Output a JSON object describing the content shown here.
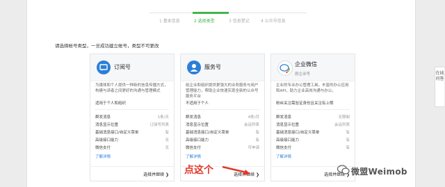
{
  "steps": [
    {
      "label": "1 基本信息",
      "active": false
    },
    {
      "label": "2 选择类型",
      "active": true
    },
    {
      "label": "3 信息登记",
      "active": false
    },
    {
      "label": "4 公众号信息",
      "active": false
    }
  ],
  "intro": "请选择帐号类型，一旦成功建立帐号，类型不可更改",
  "cards": [
    {
      "title": "订阅号",
      "subtitle": "",
      "icon": "subscription-icon",
      "description": "为媒体和个人提供一种新的信息传播方式，构建与读者之间更好的沟通与管理模式",
      "scope": "适用于个人和组织",
      "features": [
        {
          "name": "群发消息",
          "value": "1条/天"
        },
        {
          "name": "消息显示位置",
          "value": "订阅号列表"
        },
        {
          "name": "基础消息接口/自定义菜单",
          "value": "有"
        },
        {
          "name": "高级接口能力",
          "value": "无"
        },
        {
          "name": "微信支付",
          "value": "无"
        }
      ],
      "more": "了解详情",
      "action": "选择并继续 ❯"
    },
    {
      "title": "服务号",
      "subtitle": "",
      "icon": "service-icon",
      "description": "给企业和组织提供更强大的业务服务与用户管理能力，帮助企业快速实现全新的公众号服务平台",
      "scope": "不适用于个人",
      "features": [
        {
          "name": "群发消息",
          "value": "4条/月"
        },
        {
          "name": "消息显示位置",
          "value": "会话列表"
        },
        {
          "name": "基础消息接口/自定义菜单",
          "value": "有"
        },
        {
          "name": "高级接口能力",
          "value": "有"
        },
        {
          "name": "微信支付",
          "value": "可申请"
        }
      ],
      "more": "了解详情",
      "action": "选择并继续 ❯"
    },
    {
      "title": "企业微信",
      "subtitle": "原企业号",
      "icon": "work-wechat-icon",
      "description": "企业的专业办公管理工具，丰富的办公应用和API，助力企业高效沟通与办公。",
      "scope": "粉丝关注需验证身份且关注有上限",
      "features": [
        {
          "name": "群发消息",
          "value": "无限制"
        },
        {
          "name": "消息显示位置",
          "value": "会话列表"
        },
        {
          "name": "基础消息接口/自定义菜单",
          "value": "有"
        },
        {
          "name": "高级接口能力",
          "value": "有"
        },
        {
          "name": "微信支付",
          "value": "有"
        }
      ],
      "more": "了解详情",
      "action": "选择并继续 ❯"
    }
  ],
  "side_tab": "在线问答",
  "annotation": "点这个",
  "watermark": "微盟Weimob",
  "colors": {
    "accent": "#44b549",
    "link": "#2b7fd8",
    "annotation": "#e4362b"
  }
}
